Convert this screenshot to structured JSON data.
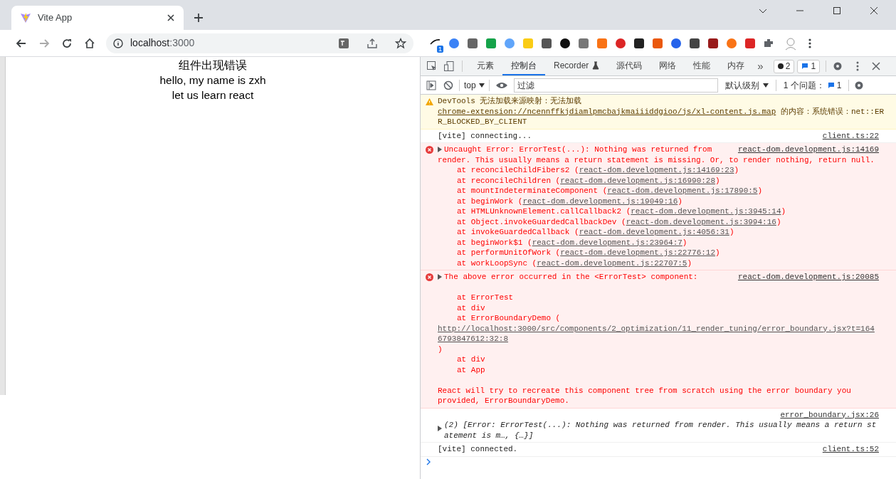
{
  "browser": {
    "tabs": [
      {
        "title": "Vite App",
        "selected": true
      }
    ],
    "url_host": "localhost",
    "url_port": ":3000",
    "extension_badge": "1"
  },
  "page": {
    "lines": [
      "组件出现错误",
      "hello, my name is zxh",
      "let us learn react"
    ]
  },
  "devtools": {
    "tabs": [
      {
        "label": "元素",
        "selected": false
      },
      {
        "label": "控制台",
        "selected": true
      },
      {
        "label": "Recorder",
        "selected": false
      },
      {
        "label": "源代码",
        "selected": false
      },
      {
        "label": "网络",
        "selected": false
      },
      {
        "label": "性能",
        "selected": false
      },
      {
        "label": "内存",
        "selected": false
      }
    ],
    "overflow": "»",
    "error_count": "2",
    "message_count": "1",
    "context": "top",
    "filter_placeholder": "过滤",
    "level": "默认级别",
    "issues_label": "1 个问题：",
    "issues_count": "1",
    "messages": [
      {
        "kind": "warning",
        "text": "DevTools 无法加载来源映射：无法加载 ",
        "link": "chrome-extension://ncennffkjdiamlpmcbajkmaiiiddgioo/js/xl-content.js.map",
        "after": " 的内容：系统错误：net::ERR_BLOCKED_BY_CLIENT"
      },
      {
        "kind": "log",
        "text": "[vite] connecting...",
        "source": "client.ts:22"
      },
      {
        "kind": "error",
        "text": "Uncaught Error: ErrorTest(...): Nothing was returned from",
        "continuation": "render. This usually means a return statement is missing. Or, to render nothing, return null.",
        "source": "react-dom.development.js:14169",
        "stack": [
          {
            "prefix": "at reconcileChildFibers2 (",
            "link": "react-dom.development.js:14169:23",
            "suffix": ")"
          },
          {
            "prefix": "at reconcileChildren (",
            "link": "react-dom.development.js:16990:28",
            "suffix": ")"
          },
          {
            "prefix": "at mountIndeterminateComponent (",
            "link": "react-dom.development.js:17890:5",
            "suffix": ")"
          },
          {
            "prefix": "at beginWork (",
            "link": "react-dom.development.js:19049:16",
            "suffix": ")"
          },
          {
            "prefix": "at HTMLUnknownElement.callCallback2 (",
            "link": "react-dom.development.js:3945:14",
            "suffix": ")"
          },
          {
            "prefix": "at Object.invokeGuardedCallbackDev (",
            "link": "react-dom.development.js:3994:16",
            "suffix": ")"
          },
          {
            "prefix": "at invokeGuardedCallback (",
            "link": "react-dom.development.js:4056:31",
            "suffix": ")"
          },
          {
            "prefix": "at beginWork$1 (",
            "link": "react-dom.development.js:23964:7",
            "suffix": ")"
          },
          {
            "prefix": "at performUnitOfWork (",
            "link": "react-dom.development.js:22776:12",
            "suffix": ")"
          },
          {
            "prefix": "at workLoopSync (",
            "link": "react-dom.development.js:22707:5",
            "suffix": ")"
          }
        ]
      },
      {
        "kind": "error",
        "text": "The above error occurred in the <ErrorTest> component:",
        "source": "react-dom.development.js:20085",
        "stack": [
          {
            "prefix": "at ErrorTest"
          },
          {
            "prefix": "at div"
          },
          {
            "prefix": "at ErrorBoundaryDemo (",
            "link": "http://localhost:3000/src/components/2_optimization/11_render_tuning/error_boundary.jsx?t=1646793847612:32:8",
            "suffix": ")"
          },
          {
            "prefix": "at div"
          },
          {
            "prefix": "at App"
          }
        ],
        "footer": "React will try to recreate this component tree from scratch using the error boundary you provided, ErrorBoundaryDemo."
      },
      {
        "kind": "object",
        "text": "(2) [Error: ErrorTest(...): Nothing was returned from render. This usually means a return statement is m…, {…}]",
        "source": "error_boundary.jsx:26"
      },
      {
        "kind": "log",
        "text": "[vite] connected.",
        "source": "client.ts:52"
      }
    ]
  }
}
